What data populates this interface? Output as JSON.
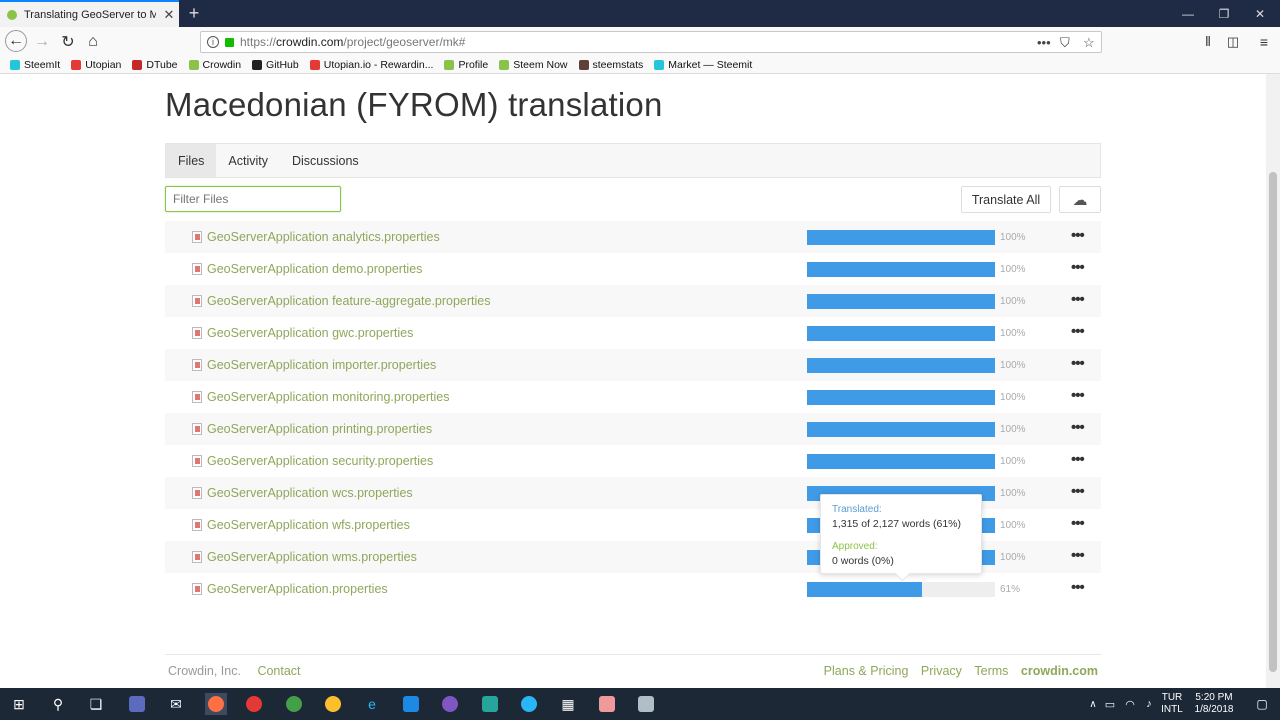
{
  "browser": {
    "tab_title": "Translating GeoServer to Mace",
    "tab_close": "✕",
    "new_tab": "+",
    "url_prefix": "https://",
    "url_host": "crowdin.com",
    "url_path": "/project/geoserver/mk#",
    "page_actions": "•••",
    "bookmarks": [
      {
        "label": "SteemIt",
        "color": "#26c6da"
      },
      {
        "label": "Utopian",
        "color": "#e53935"
      },
      {
        "label": "DTube",
        "color": "#c62828"
      },
      {
        "label": "Crowdin",
        "color": "#8bc34a"
      },
      {
        "label": "GitHub",
        "color": "#222222"
      },
      {
        "label": "Utopian.io - Rewardin...",
        "color": "#e53935"
      },
      {
        "label": "Profile",
        "color": "#8bc34a"
      },
      {
        "label": "Steem Now",
        "color": "#8bc34a"
      },
      {
        "label": "steemstats",
        "color": "#5d4037"
      },
      {
        "label": "Market — Steemit",
        "color": "#26c6da"
      }
    ]
  },
  "page": {
    "title": "Macedonian (FYROM) translation",
    "tabs": [
      {
        "label": "Files",
        "active": true
      },
      {
        "label": "Activity",
        "active": false
      },
      {
        "label": "Discussions",
        "active": false
      }
    ],
    "filter_placeholder": "Filter Files",
    "translate_all": "Translate All",
    "more": "•••",
    "files": [
      {
        "name": "GeoServerApplication analytics.properties",
        "progress": 100,
        "pct": "100%"
      },
      {
        "name": "GeoServerApplication demo.properties",
        "progress": 100,
        "pct": "100%"
      },
      {
        "name": "GeoServerApplication feature-aggregate.properties",
        "progress": 100,
        "pct": "100%"
      },
      {
        "name": "GeoServerApplication gwc.properties",
        "progress": 100,
        "pct": "100%"
      },
      {
        "name": "GeoServerApplication importer.properties",
        "progress": 100,
        "pct": "100%"
      },
      {
        "name": "GeoServerApplication monitoring.properties",
        "progress": 100,
        "pct": "100%"
      },
      {
        "name": "GeoServerApplication printing.properties",
        "progress": 100,
        "pct": "100%"
      },
      {
        "name": "GeoServerApplication security.properties",
        "progress": 100,
        "pct": "100%"
      },
      {
        "name": "GeoServerApplication wcs.properties",
        "progress": 100,
        "pct": "100%"
      },
      {
        "name": "GeoServerApplication wfs.properties",
        "progress": 100,
        "pct": "100%"
      },
      {
        "name": "GeoServerApplication wms.properties",
        "progress": 100,
        "pct": "100%"
      },
      {
        "name": "GeoServerApplication.properties",
        "progress": 61,
        "pct": "61%"
      }
    ],
    "tooltip": {
      "translated_label": "Translated:",
      "translated_value": "1,315 of 2,127 words (61%)",
      "approved_label": "Approved:",
      "approved_value": "0 words (0%)"
    },
    "footer": {
      "company": "Crowdin, Inc.",
      "contact": "Contact",
      "links": [
        "Plans & Pricing",
        "Privacy",
        "Terms"
      ],
      "brand": "crowdin.com"
    }
  },
  "taskbar": {
    "lang": "TUR",
    "layout": "INTL",
    "time": "5:20 PM",
    "date": "1/8/2018"
  }
}
